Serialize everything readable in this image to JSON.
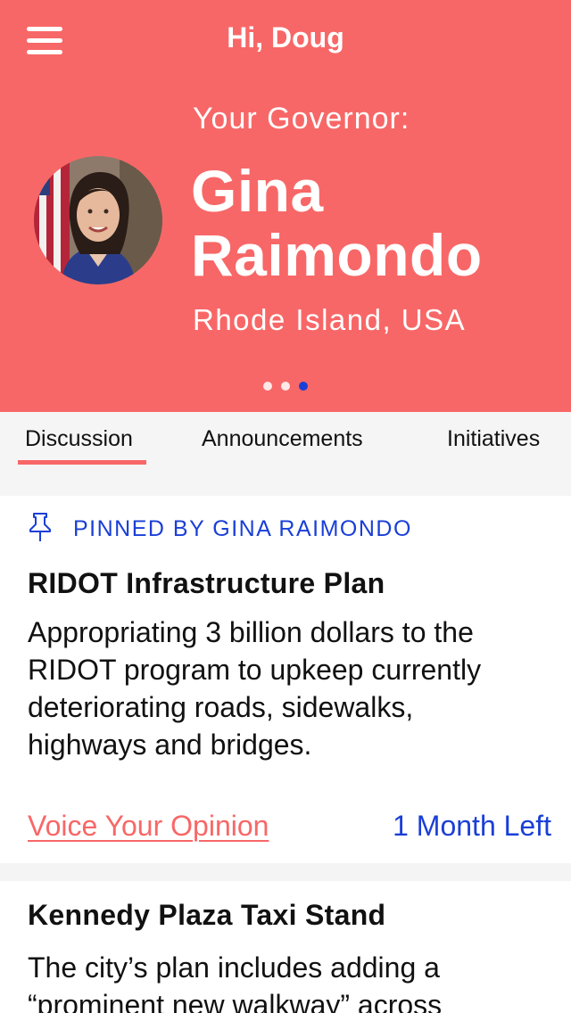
{
  "header": {
    "greeting": "Hi, Doug",
    "menu_icon": "hamburger-menu-icon"
  },
  "governor": {
    "label": "Your Governor:",
    "first_name": "Gina",
    "last_name": "Raimondo",
    "location": "Rhode Island, USA",
    "avatar_icon": "governor-avatar"
  },
  "carousel": {
    "count": 3,
    "active_index": 2
  },
  "tabs": [
    {
      "label": "Discussion",
      "active": true
    },
    {
      "label": "Announcements",
      "active": false
    },
    {
      "label": "Initiatives",
      "active": false
    }
  ],
  "posts": [
    {
      "pinned_label": "PINNED BY GINA RAIMONDO",
      "pin_icon": "pin-icon",
      "title": "RIDOT Infrastructure Plan",
      "body_lines": [
        "Appropriating 3 billion dollars to the",
        "RIDOT program to upkeep currently",
        "deteriorating roads, sidewalks,",
        "highways and bridges."
      ],
      "action_label": "Voice Your Opinion",
      "time_left": "1 Month Left"
    },
    {
      "title": "Kennedy Plaza Taxi Stand",
      "body_lines": [
        "The city’s plan includes adding a",
        "“prominent new walkway” across"
      ]
    }
  ],
  "colors": {
    "brand_coral": "#f86767",
    "accent_blue": "#1a3fd6"
  }
}
